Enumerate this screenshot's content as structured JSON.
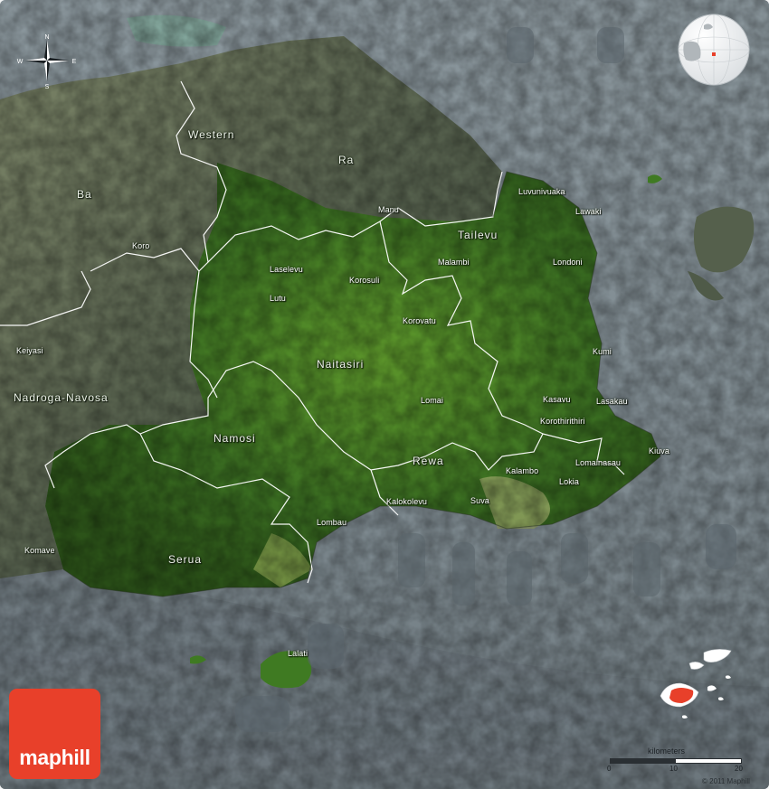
{
  "colors": {
    "sea": "#7d8a92",
    "land_dry": "#5e6a55",
    "land_green": "#3f7a22",
    "boundary": "#ffffff",
    "brand": "#e8402a"
  },
  "compass": {
    "n": "N",
    "s": "S",
    "e": "E",
    "w": "W"
  },
  "regions": {
    "western": "Western",
    "ra": "Ra",
    "ba": "Ba",
    "tailevu": "Tailevu",
    "naitasiri": "Naitasiri",
    "nadroga_navosa": "Nadroga-Navosa",
    "namosi": "Namosi",
    "rewa": "Rewa",
    "serua": "Serua"
  },
  "places": {
    "luvunivuaka": "Luvunivuaka",
    "lawaki": "Lawaki",
    "manu": "Manu",
    "malambi": "Malambi",
    "londoni": "Londoni",
    "koro": "Koro",
    "laselevu": "Laselevu",
    "korosuli": "Korosuli",
    "lutu": "Lutu",
    "korovatu": "Korovatu",
    "keiyasi": "Keiyasi",
    "kumi": "Kumi",
    "kasavu": "Kasavu",
    "lasakau": "Lasakau",
    "lomai": "Lomai",
    "korothirithiri": "Korothirithiri",
    "kiuva": "Kiuva",
    "lomainasau": "Lomainasau",
    "kalambo": "Kalambo",
    "lokia": "Lokia",
    "kalokolevu": "Kalokolevu",
    "suva": "Suva",
    "lombau": "Lombau",
    "komave": "Komave",
    "lalati": "Lalati"
  },
  "logo": {
    "text": "maphill"
  },
  "scale": {
    "title": "kilometers",
    "ticks": [
      "0",
      "10",
      "20"
    ]
  },
  "copyright": "© 2011 Maphill"
}
